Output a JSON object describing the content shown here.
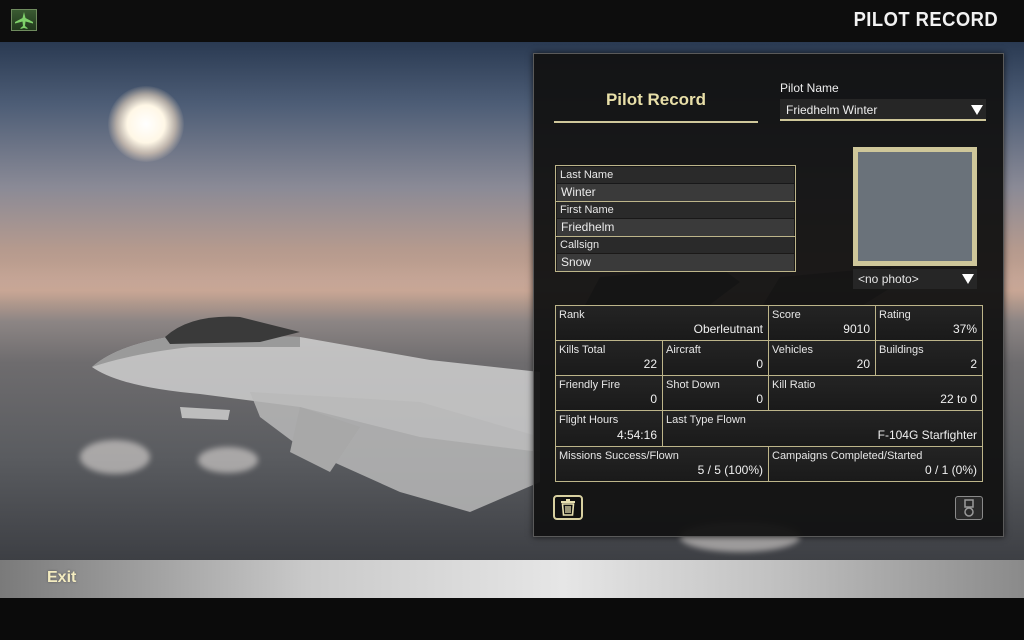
{
  "header": {
    "screen_title": "PILOT RECORD",
    "home_icon": "aircraft-icon"
  },
  "panel": {
    "title": "Pilot Record",
    "pilot_name_label": "Pilot Name",
    "pilot_name_value": "Friedhelm Winter",
    "last_name_label": "Last Name",
    "last_name_value": "Winter",
    "first_name_label": "First Name",
    "first_name_value": "Friedhelm",
    "callsign_label": "Callsign",
    "callsign_value": "Snow",
    "photo_value": "<no photo>"
  },
  "stats": {
    "rank": {
      "label": "Rank",
      "value": "Oberleutnant"
    },
    "score": {
      "label": "Score",
      "value": "9010"
    },
    "rating": {
      "label": "Rating",
      "value": "37%"
    },
    "kills_total": {
      "label": "Kills Total",
      "value": "22"
    },
    "aircraft": {
      "label": "Aircraft",
      "value": "0"
    },
    "vehicles": {
      "label": "Vehicles",
      "value": "20"
    },
    "buildings": {
      "label": "Buildings",
      "value": "2"
    },
    "friendly_fire": {
      "label": "Friendly Fire",
      "value": "0"
    },
    "shot_down": {
      "label": "Shot Down",
      "value": "0"
    },
    "kill_ratio": {
      "label": "Kill Ratio",
      "value": "22 to 0"
    },
    "flight_hours": {
      "label": "Flight Hours",
      "value": "4:54:16"
    },
    "last_type": {
      "label": "Last Type Flown",
      "value": "F-104G Starfighter"
    },
    "missions": {
      "label": "Missions Success/Flown",
      "value": "5 / 5 (100%)"
    },
    "campaigns": {
      "label": "Campaigns Completed/Started",
      "value": "0 / 1 (0%)"
    }
  },
  "footer": {
    "exit_label": "Exit"
  },
  "colors": {
    "accent": "#cfc79a",
    "title_text": "#e8dfa8"
  }
}
